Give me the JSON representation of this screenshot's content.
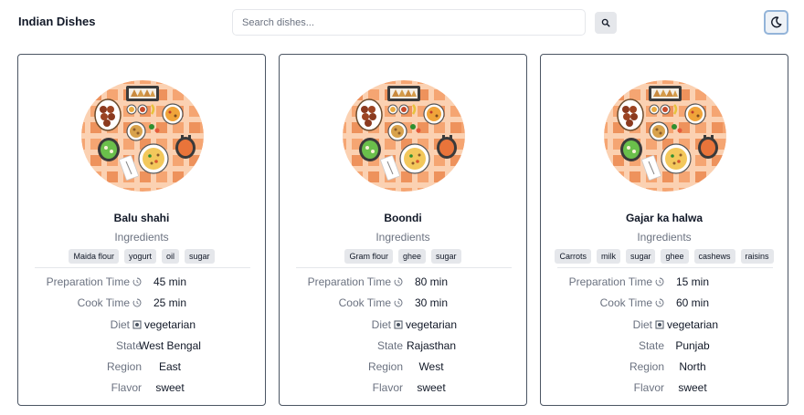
{
  "header": {
    "title": "Indian Dishes",
    "search_placeholder": "Search dishes...",
    "search_icon": "search-icon",
    "theme_icon": "moon-icon"
  },
  "labels": {
    "ingredients": "Ingredients",
    "prep_time": "Preparation Time",
    "cook_time": "Cook Time",
    "diet": "Diet",
    "state": "State",
    "region": "Region",
    "flavor": "Flavor"
  },
  "dishes": [
    {
      "name": "Balu shahi",
      "ingredients": [
        "Maida flour",
        "yogurt",
        "oil",
        "sugar"
      ],
      "prep_time": "45 min",
      "cook_time": "25 min",
      "diet": "vegetarian",
      "state": "West Bengal",
      "region": "East",
      "flavor": "sweet"
    },
    {
      "name": "Boondi",
      "ingredients": [
        "Gram flour",
        "ghee",
        "sugar"
      ],
      "prep_time": "80 min",
      "cook_time": "30 min",
      "diet": "vegetarian",
      "state": "Rajasthan",
      "region": "West",
      "flavor": "sweet"
    },
    {
      "name": "Gajar ka halwa",
      "ingredients": [
        "Carrots",
        "milk",
        "sugar",
        "ghee",
        "cashews",
        "raisins"
      ],
      "prep_time": "15 min",
      "cook_time": "60 min",
      "diet": "vegetarian",
      "state": "Punjab",
      "region": "North",
      "flavor": "sweet"
    }
  ],
  "colors": {
    "card_border": "#4b5563",
    "tag_bg": "#e5e7eb",
    "label_text": "#6b7280",
    "plate_orange": "#f5a572"
  }
}
